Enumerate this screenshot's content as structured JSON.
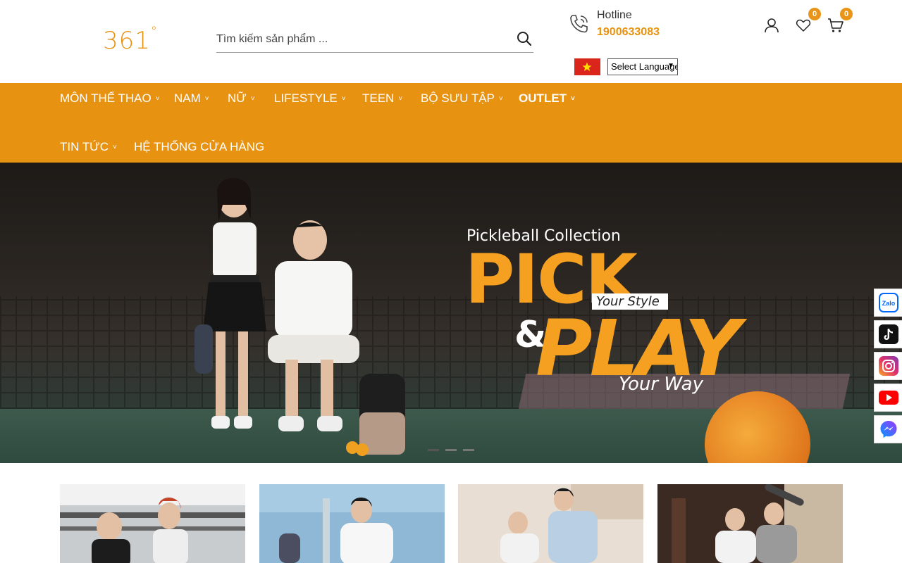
{
  "brand": {
    "logo_text": "361",
    "logo_degree": "°",
    "accent": "#E89212"
  },
  "search": {
    "placeholder": "Tìm kiếm sản phẩm ...",
    "icon": "search-icon"
  },
  "hotline": {
    "label": "Hotline",
    "number": "1900633083",
    "icon": "phone-icon"
  },
  "header_icons": {
    "account_icon": "user-icon",
    "wishlist_icon": "heart-icon",
    "wishlist_count": "0",
    "cart_icon": "cart-icon",
    "cart_count": "0"
  },
  "language": {
    "flag": "vietnam-flag",
    "select_label": "Select Language"
  },
  "nav": {
    "items": [
      {
        "label": "MÔN THỂ THAO",
        "has_dropdown": true
      },
      {
        "label": "NAM",
        "has_dropdown": true
      },
      {
        "label": "NỮ",
        "has_dropdown": true
      },
      {
        "label": "LIFESTYLE",
        "has_dropdown": true
      },
      {
        "label": "TEEN",
        "has_dropdown": true
      },
      {
        "label": "BỘ SƯU TẬP",
        "has_dropdown": true
      },
      {
        "label": "OUTLET",
        "has_dropdown": true
      },
      {
        "label": "TIN TỨC",
        "has_dropdown": true
      },
      {
        "label": "HỆ THỐNG CỬA HÀNG",
        "has_dropdown": false
      }
    ],
    "chevron": "˅"
  },
  "hero": {
    "subtitle": "Pickleball Collection",
    "headline_1": "PICK",
    "ampersand": "&",
    "headline_2": "PLAY",
    "tag_1": "Your Style",
    "tag_2": "Your Way",
    "slides": 3,
    "active_slide": 1
  },
  "social": [
    "zalo-icon",
    "tiktok-icon",
    "instagram-icon",
    "youtube-icon",
    "messenger-icon"
  ],
  "social_labels": {
    "zalo": "Zalo"
  },
  "categories": [
    {
      "name": "category-tile-1"
    },
    {
      "name": "category-tile-2"
    },
    {
      "name": "category-tile-3"
    },
    {
      "name": "category-tile-4"
    }
  ]
}
